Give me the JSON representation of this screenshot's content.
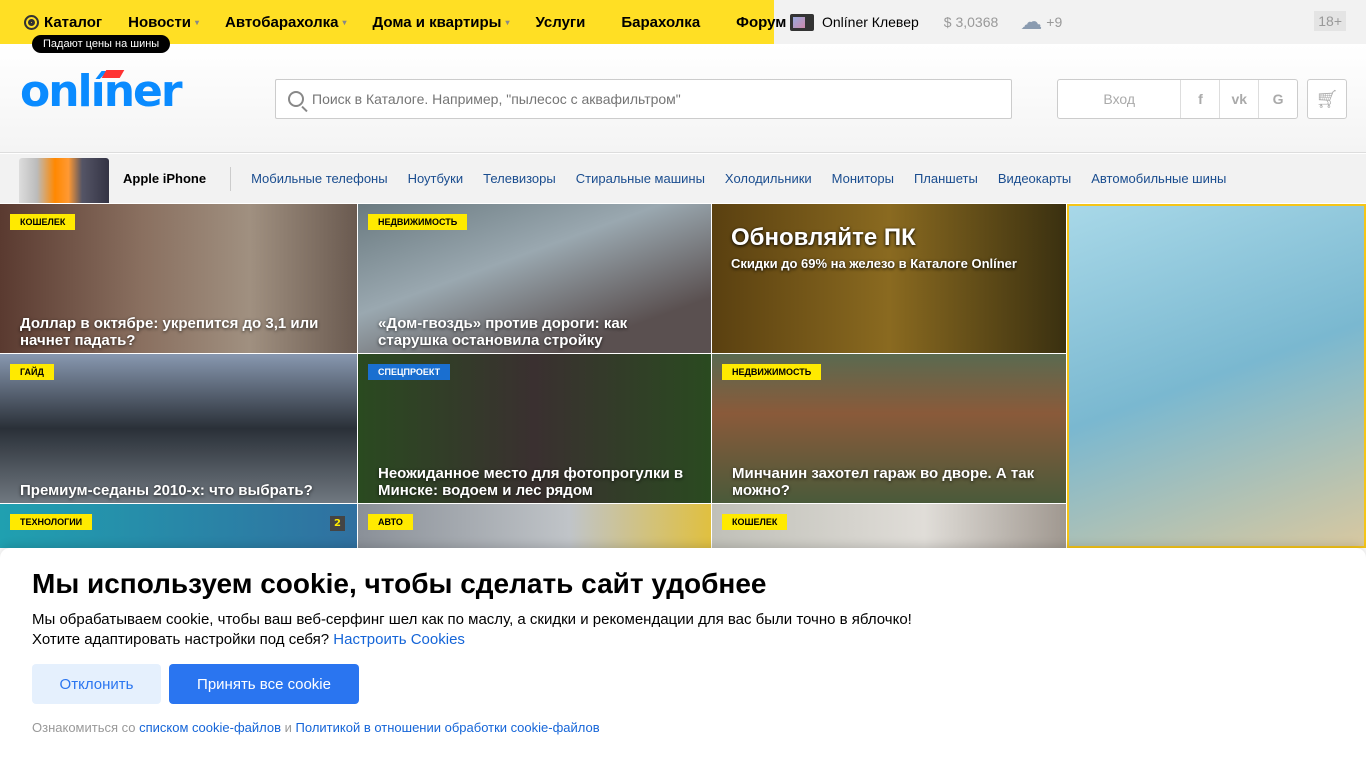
{
  "topnav": {
    "items": [
      {
        "label": "Каталог",
        "icon": "catalog-icon"
      },
      {
        "label": "Новости",
        "dropdown": true
      },
      {
        "label": "Автобарахолка",
        "dropdown": true
      },
      {
        "label": "Дома и квартиры",
        "dropdown": true
      },
      {
        "label": "Услуги"
      },
      {
        "label": "Барахолка"
      },
      {
        "label": "Форум"
      }
    ],
    "tooltip": "Падают цены на шины",
    "klever": "Onlíner Клевер",
    "currency": "$ 3,0368",
    "weather": "+9",
    "age": "18+"
  },
  "header": {
    "logo": "onlíner",
    "search_placeholder": "Поиск в Каталоге. Например, \"пылесос с аквафильтром\"",
    "login": "Вход",
    "social": [
      "f",
      "vk",
      "G"
    ]
  },
  "catbar": {
    "featured": "Apple iPhone",
    "links": [
      "Мобильные телефоны",
      "Ноутбуки",
      "Телевизоры",
      "Стиральные машины",
      "Холодильники",
      "Мониторы",
      "Планшеты",
      "Видеокарты",
      "Автомобильные шины"
    ]
  },
  "tiles": [
    {
      "badge": "КОШЕЛЕК",
      "title": "Доллар в октябре: укрепится до 3,1 или начнет падать?"
    },
    {
      "badge": "НЕДВИЖИМОСТЬ",
      "title": "«Дом-гвоздь» против дороги: как старушка остановила стройку"
    },
    {
      "promo_title": "Обновляйте ПК",
      "promo_sub": "Скидки до 69% на железо в Каталоге Onlíner"
    },
    {
      "badge": "ГАЙД",
      "title": "Премиум-седаны 2010-х: что выбрать?"
    },
    {
      "badge": "СПЕЦПРОЕКТ",
      "title": "Неожиданное место для фотопрогулки в Минске: водоем и лес рядом"
    },
    {
      "badge": "НЕДВИЖИМОСТЬ",
      "title": "Минчанин захотел гараж во дворе. А так можно?"
    },
    {
      "badge": "ТЕХНОЛОГИИ",
      "comments": "2"
    },
    {
      "badge": "АВТО"
    },
    {
      "badge": "КОШЕЛЕК"
    }
  ],
  "cookie": {
    "title": "Мы используем cookie, чтобы сделать сайт удобнее",
    "line1": "Мы обрабатываем cookie, чтобы ваш веб-серфинг шел как по маслу, а скидки и рекомендации для вас были точно в яблочко!",
    "line2": "Хотите адаптировать настройки под себя?",
    "settings_link": "Настроить Cookies",
    "decline": "Отклонить",
    "accept": "Принять все cookie",
    "foot_prefix": "Ознакомиться со",
    "foot_link1": "списком cookie-файлов",
    "foot_and": "и",
    "foot_link2": "Политикой в отношении обработки cookie-файлов"
  }
}
